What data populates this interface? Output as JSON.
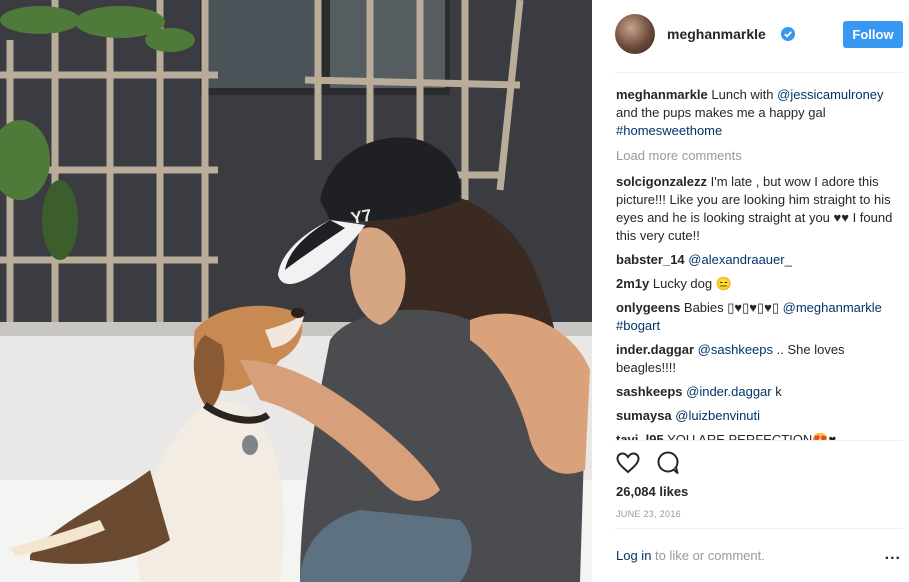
{
  "post": {
    "username": "meghanmarkle",
    "follow_label": "Follow",
    "caption": {
      "username": "meghanmarkle",
      "text_1": " Lunch with ",
      "mention": "@jessicamulroney",
      "text_2": " and the pups makes me a happy gal ",
      "hashtag": "#homesweethome"
    },
    "load_more": "Load more comments",
    "comments": [
      {
        "user": "solcigonzalezz",
        "text": " I'm late , but wow I adore this picture!!! Like you are looking him straight to his eyes and he is looking straight at you ♥♥ I found this very cute!!"
      },
      {
        "user": "babster_14",
        "mention": "@alexandraauer_"
      },
      {
        "user": "2m1y",
        "text": " Lucky dog 😑"
      },
      {
        "user": "onlygeens",
        "text": " Babies ▯♥▯♥▯♥▯ ",
        "mention": "@meghanmarkle",
        "hashtag": " #bogart"
      },
      {
        "user": "inder.daggar",
        "mention": "@sashkeeps",
        "text": " .. She loves beagles!!!!"
      },
      {
        "user": "sashkeeps",
        "mention": "@inder.daggar",
        "text": " k"
      },
      {
        "user": "sumaysa",
        "mention": "@luizbenvinuti"
      },
      {
        "user": "tavi_l95",
        "text": " YOU ARE PERFECTION😍♥"
      }
    ],
    "likes": "26,084 likes",
    "date": "JUNE 23, 2016",
    "login_link": "Log in",
    "login_rest": " to like or comment.",
    "more_label": "..."
  },
  "icons": [
    "verified-badge-icon",
    "heart-icon",
    "comment-icon",
    "more-options-icon"
  ],
  "colors": {
    "accent": "#3897f0",
    "link": "#003569",
    "muted": "#999999",
    "text": "#262626"
  },
  "photo": {
    "cap_text": "Y7"
  }
}
